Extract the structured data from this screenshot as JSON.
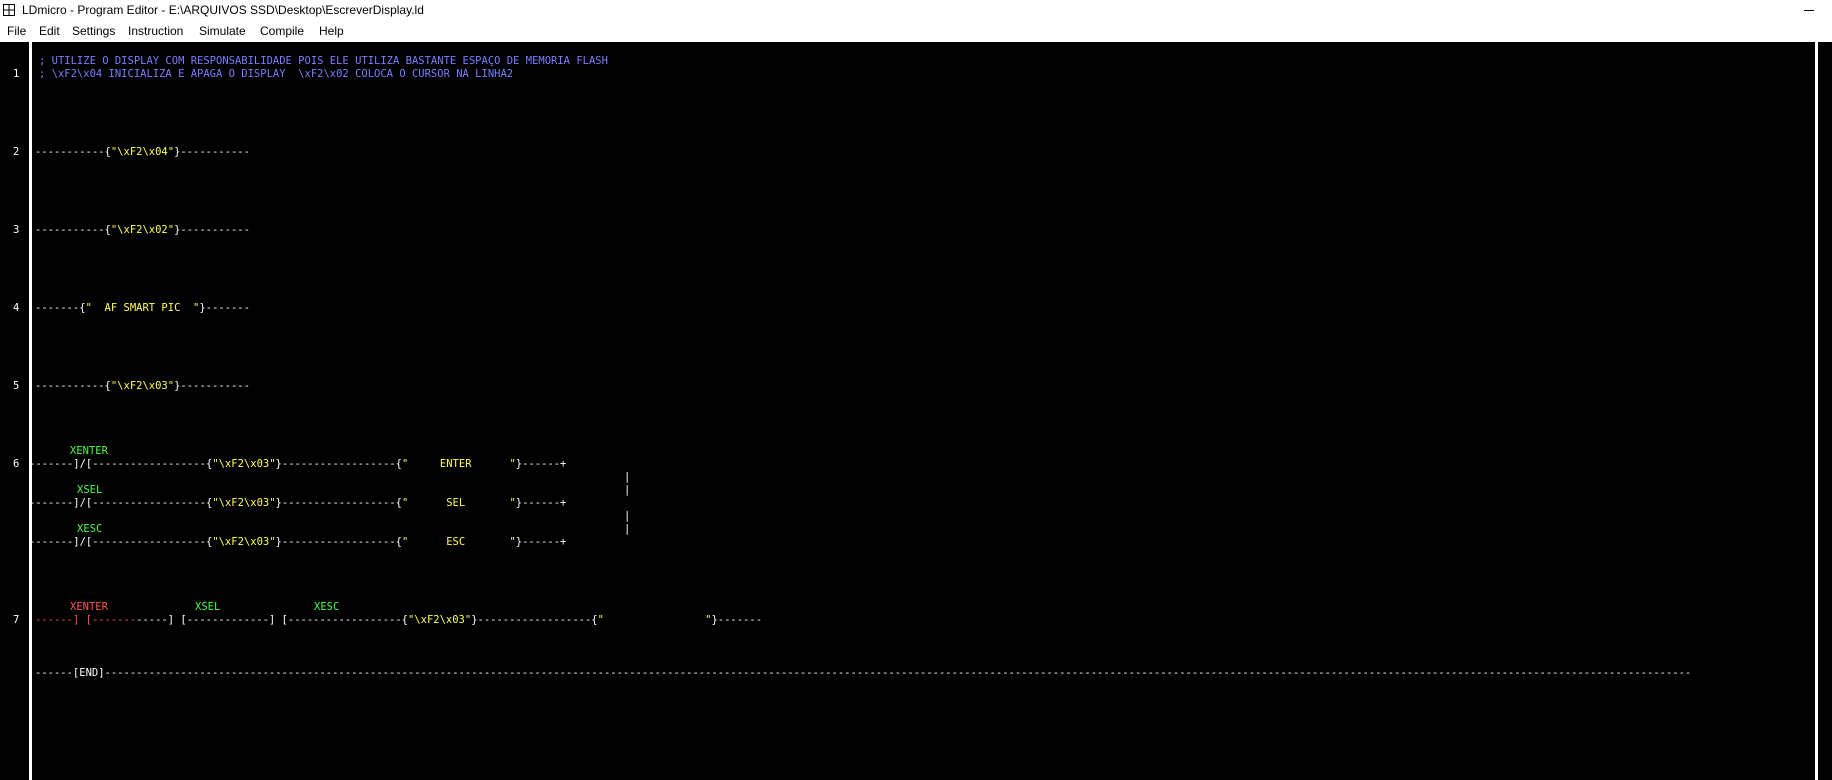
{
  "window": {
    "title": "LDmicro - Program Editor - E:\\ARQUIVOS SSD\\Desktop\\EscreverDisplay.ld",
    "app_icon": "ldmicro-app-icon",
    "controls": {
      "minimize_icon": "minimize-icon"
    }
  },
  "menu": [
    "File",
    "Edit",
    "Settings",
    "Instruction",
    "Simulate",
    "Compile",
    "Help"
  ],
  "colors": {
    "background": "#000000",
    "comment": "#7d7dff",
    "string": "#ffff50",
    "contact_off": "#44ff44",
    "contact_on": "#ff5555",
    "wire": "#ffffff"
  },
  "rungs": {
    "r1": {
      "number": "1",
      "comment1": "; UTILIZE O DISPLAY COM RESPONSABILIDADE POIS ELE UTILIZA BASTANTE ESPAÇO DE MEMORIA FLASH",
      "comment2": "; \\xF2\\x04 INICIALIZA E APAGA O DISPLAY  \\xF2\\x02 COLOCA O CURSOR NA LINHA2"
    },
    "r2": {
      "number": "2",
      "pre": "-----------{",
      "str": "\"\\xF2\\x04\"",
      "post": "}-----------"
    },
    "r3": {
      "number": "3",
      "pre": "-----------{",
      "str": "\"\\xF2\\x02\"",
      "post": "}-----------"
    },
    "r4": {
      "number": "4",
      "pre": "-------{",
      "str": "\"  AF SMART PIC  \"",
      "post": "}-------"
    },
    "r5": {
      "number": "5",
      "pre": "-----------{",
      "str": "\"\\xF2\\x03\"",
      "post": "}-----------"
    },
    "r6": {
      "number": "6",
      "contact1": "XENTER",
      "contact2": "XSEL",
      "contact3": "XESC",
      "line1_pre": "-------]/[------------------{",
      "line1_str1": "\"\\xF2\\x03\"",
      "line1_mid": "}------------------{",
      "line1_str2": "\"     ENTER      \"",
      "line1_post": "}------+",
      "line2_pre": "-------]/[------------------{",
      "line2_str1": "\"\\xF2\\x03\"",
      "line2_mid": "}------------------{",
      "line2_str2": "\"      SEL       \"",
      "line2_post": "}------+",
      "line3_pre": "-------]/[------------------{",
      "line3_str1": "\"\\xF2\\x03\"",
      "line3_mid": "}------------------{",
      "line3_str2": "\"      ESC       \"",
      "line3_post": "}------+",
      "vbar": "|"
    },
    "r7": {
      "number": "7",
      "contact1": "XENTER",
      "contact2": "XSEL",
      "contact3": "XESC",
      "wire_on": "------] [-------",
      "wire_rest": "-----] [-------------] [------------------{",
      "str1": "\"\\xF2\\x03\"",
      "mid": "}------------------{",
      "str2": "\"                \"",
      "post": "}-------"
    },
    "end": {
      "text": "------[END]-----------------------------------------------------------------------------------------------------------------------------------------------------------------------------------------------------------------------------------------------------------"
    }
  }
}
